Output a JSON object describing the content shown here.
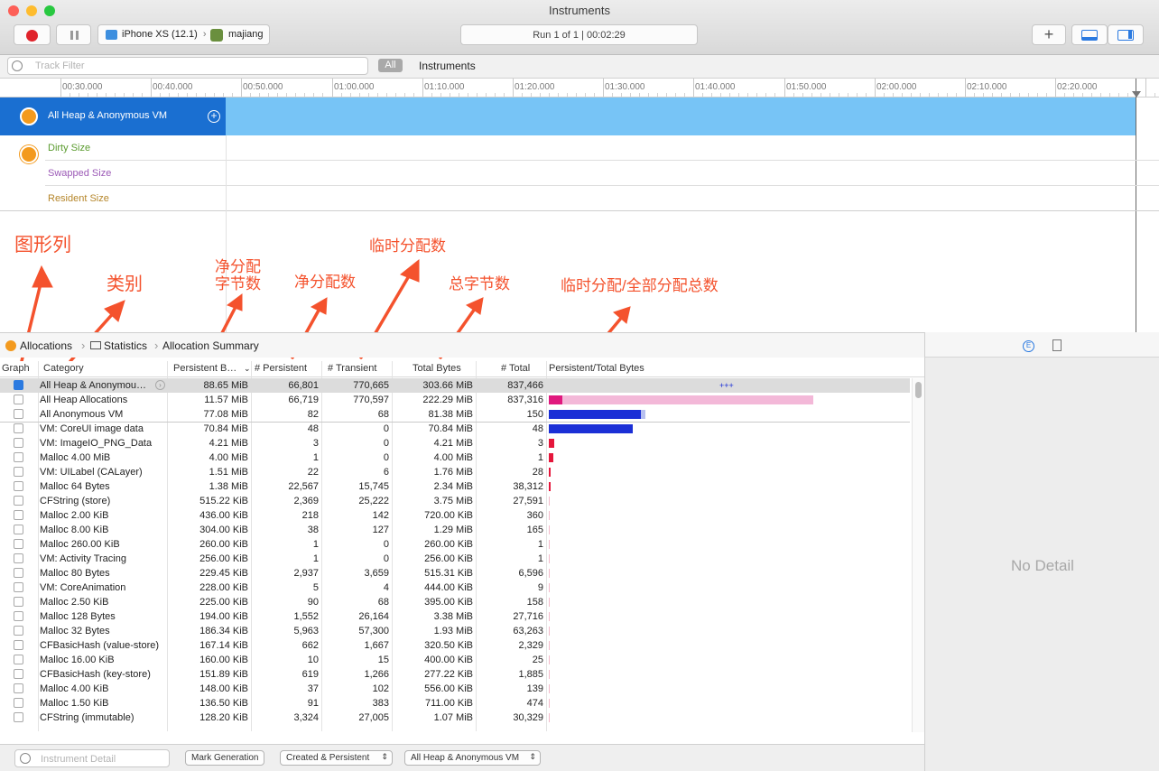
{
  "window": {
    "title": "Instruments"
  },
  "toolbar": {
    "device": "iPhone XS (12.1)",
    "app": "majiang",
    "run_status": "Run 1 of 1  |  00:02:29",
    "add_symbol": "+"
  },
  "filter": {
    "placeholder": "Track Filter",
    "scope_all": "All",
    "scope_instruments": "Instruments"
  },
  "ruler": {
    "labels": [
      "00:30.000",
      "00:40.000",
      "00:50.000",
      "01:00.000",
      "01:10.000",
      "01:20.000",
      "01:30.000",
      "01:40.000",
      "01:50.000",
      "02:00.000",
      "02:10.000",
      "02:20.000"
    ]
  },
  "tracks": {
    "main": "All Heap & Anonymous VM",
    "sub": [
      "Dirty Size",
      "Swapped Size",
      "Resident Size"
    ]
  },
  "annotations": {
    "graph_col": "图形列",
    "category": "类别",
    "persistent_bytes": "净分配\n字节数",
    "persistent_count": "净分配数",
    "transient": "临时分配数",
    "total_bytes": "总字节数",
    "ratio": "临时分配/全部分配总数"
  },
  "breadcrumb": [
    "Allocations",
    "Statistics",
    "Allocation Summary"
  ],
  "table": {
    "headers": [
      "Graph",
      "Category",
      "Persistent B…",
      "# Persistent",
      "# Transient",
      "Total Bytes",
      "# Total",
      "Persistent/Total Bytes"
    ],
    "rows": [
      {
        "checked": true,
        "category": "All Heap & Anonymou…",
        "pbytes": "88.65 MiB",
        "persistent": "66,801",
        "transient": "770,665",
        "total_bytes": "303.66 MiB",
        "total": "837,466",
        "bar": "+++",
        "bar_frac": 0,
        "bar_color": "#1b2fd6"
      },
      {
        "checked": false,
        "category": "All Heap Allocations",
        "pbytes": "11.57 MiB",
        "persistent": "66,719",
        "transient": "770,597",
        "total_bytes": "222.29 MiB",
        "total": "837,316",
        "bar_frac": 0.052,
        "bar_total_frac": 1.0,
        "bar_color": "#e0197e",
        "bar_bg": "#f3b8d8"
      },
      {
        "checked": false,
        "category": "All Anonymous VM",
        "pbytes": "77.08 MiB",
        "persistent": "82",
        "transient": "68",
        "total_bytes": "81.38 MiB",
        "total": "150",
        "bar_frac": 0.347,
        "bar_total_frac": 0.366,
        "bar_color": "#1b2fd6",
        "bar_bg": "#b7c0f0"
      },
      {
        "checked": false,
        "category": "VM: CoreUI image data",
        "pbytes": "70.84 MiB",
        "persistent": "48",
        "transient": "0",
        "total_bytes": "70.84 MiB",
        "total": "48",
        "bar_frac": 0.319,
        "bar_total_frac": 0.319,
        "bar_color": "#1b2fd6"
      },
      {
        "checked": false,
        "category": "VM: ImageIO_PNG_Data",
        "pbytes": "4.21 MiB",
        "persistent": "3",
        "transient": "0",
        "total_bytes": "4.21 MiB",
        "total": "3",
        "bar_frac": 0.019,
        "bar_color": "#e5163b"
      },
      {
        "checked": false,
        "category": "Malloc 4.00 MiB",
        "pbytes": "4.00 MiB",
        "persistent": "1",
        "transient": "0",
        "total_bytes": "4.00 MiB",
        "total": "1",
        "bar_frac": 0.018,
        "bar_color": "#e5163b"
      },
      {
        "checked": false,
        "category": "VM: UILabel (CALayer)",
        "pbytes": "1.51 MiB",
        "persistent": "22",
        "transient": "6",
        "total_bytes": "1.76 MiB",
        "total": "28",
        "bar_frac": 0.007,
        "bar_color": "#e5163b"
      },
      {
        "checked": false,
        "category": "Malloc 64 Bytes",
        "pbytes": "1.38 MiB",
        "persistent": "22,567",
        "transient": "15,745",
        "total_bytes": "2.34 MiB",
        "total": "38,312",
        "bar_frac": 0.006,
        "bar_color": "#e5163b"
      },
      {
        "checked": false,
        "category": "CFString (store)",
        "pbytes": "515.22 KiB",
        "persistent": "2,369",
        "transient": "25,222",
        "total_bytes": "3.75 MiB",
        "total": "27,591",
        "bar_frac": 0.005,
        "bar_color": "#f3b8c8"
      },
      {
        "checked": false,
        "category": "Malloc 2.00 KiB",
        "pbytes": "436.00 KiB",
        "persistent": "218",
        "transient": "142",
        "total_bytes": "720.00 KiB",
        "total": "360",
        "bar_frac": 0,
        "bar_color": "#f3b8c8"
      },
      {
        "checked": false,
        "category": "Malloc 8.00 KiB",
        "pbytes": "304.00 KiB",
        "persistent": "38",
        "transient": "127",
        "total_bytes": "1.29 MiB",
        "total": "165",
        "bar_frac": 0.002,
        "bar_color": "#f3b8c8"
      },
      {
        "checked": false,
        "category": "Malloc 260.00 KiB",
        "pbytes": "260.00 KiB",
        "persistent": "1",
        "transient": "0",
        "total_bytes": "260.00 KiB",
        "total": "1",
        "bar_frac": 0,
        "bar_color": "#f3b8c8"
      },
      {
        "checked": false,
        "category": "VM: Activity Tracing",
        "pbytes": "256.00 KiB",
        "persistent": "1",
        "transient": "0",
        "total_bytes": "256.00 KiB",
        "total": "1",
        "bar_frac": 0,
        "bar_color": "#f3b8c8"
      },
      {
        "checked": false,
        "category": "Malloc 80 Bytes",
        "pbytes": "229.45 KiB",
        "persistent": "2,937",
        "transient": "3,659",
        "total_bytes": "515.31 KiB",
        "total": "6,596",
        "bar_frac": 0,
        "bar_color": "#f3b8c8"
      },
      {
        "checked": false,
        "category": "VM: CoreAnimation",
        "pbytes": "228.00 KiB",
        "persistent": "5",
        "transient": "4",
        "total_bytes": "444.00 KiB",
        "total": "9",
        "bar_frac": 0,
        "bar_color": "#f3b8c8"
      },
      {
        "checked": false,
        "category": "Malloc 2.50 KiB",
        "pbytes": "225.00 KiB",
        "persistent": "90",
        "transient": "68",
        "total_bytes": "395.00 KiB",
        "total": "158",
        "bar_frac": 0,
        "bar_color": "#f3b8c8"
      },
      {
        "checked": false,
        "category": "Malloc 128 Bytes",
        "pbytes": "194.00 KiB",
        "persistent": "1,552",
        "transient": "26,164",
        "total_bytes": "3.38 MiB",
        "total": "27,716",
        "bar_frac": 0.005,
        "bar_color": "#f3b8c8"
      },
      {
        "checked": false,
        "category": "Malloc 32 Bytes",
        "pbytes": "186.34 KiB",
        "persistent": "5,963",
        "transient": "57,300",
        "total_bytes": "1.93 MiB",
        "total": "63,263",
        "bar_frac": 0.004,
        "bar_color": "#f3b8c8"
      },
      {
        "checked": false,
        "category": "CFBasicHash (value-store)",
        "pbytes": "167.14 KiB",
        "persistent": "662",
        "transient": "1,667",
        "total_bytes": "320.50 KiB",
        "total": "2,329",
        "bar_frac": 0,
        "bar_color": "#f3b8c8"
      },
      {
        "checked": false,
        "category": "Malloc 16.00 KiB",
        "pbytes": "160.00 KiB",
        "persistent": "10",
        "transient": "15",
        "total_bytes": "400.00 KiB",
        "total": "25",
        "bar_frac": 0,
        "bar_color": "#f3b8c8"
      },
      {
        "checked": false,
        "category": "CFBasicHash (key-store)",
        "pbytes": "151.89 KiB",
        "persistent": "619",
        "transient": "1,266",
        "total_bytes": "277.22 KiB",
        "total": "1,885",
        "bar_frac": 0,
        "bar_color": "#f3b8c8"
      },
      {
        "checked": false,
        "category": "Malloc 4.00 KiB",
        "pbytes": "148.00 KiB",
        "persistent": "37",
        "transient": "102",
        "total_bytes": "556.00 KiB",
        "total": "139",
        "bar_frac": 0,
        "bar_color": "#f3b8c8"
      },
      {
        "checked": false,
        "category": "Malloc 1.50 KiB",
        "pbytes": "136.50 KiB",
        "persistent": "91",
        "transient": "383",
        "total_bytes": "711.00 KiB",
        "total": "474",
        "bar_frac": 0,
        "bar_color": "#f3b8c8"
      },
      {
        "checked": false,
        "category": "CFString (immutable)",
        "pbytes": "128.20 KiB",
        "persistent": "3,324",
        "transient": "27,005",
        "total_bytes": "1.07 MiB",
        "total": "30,329",
        "bar_frac": 0.002,
        "bar_color": "#f3b8c8"
      }
    ]
  },
  "detail": {
    "empty_text": "No Detail"
  },
  "statusbar": {
    "detail_placeholder": "Instrument Detail",
    "mark_generation": "Mark Generation",
    "lifespan": "Created & Persistent",
    "allocation_type": "All Heap & Anonymous VM"
  },
  "colors": {
    "accent": "#1a6fd1",
    "track_fill": "#77c4f6",
    "annotation": "#f4522d"
  }
}
